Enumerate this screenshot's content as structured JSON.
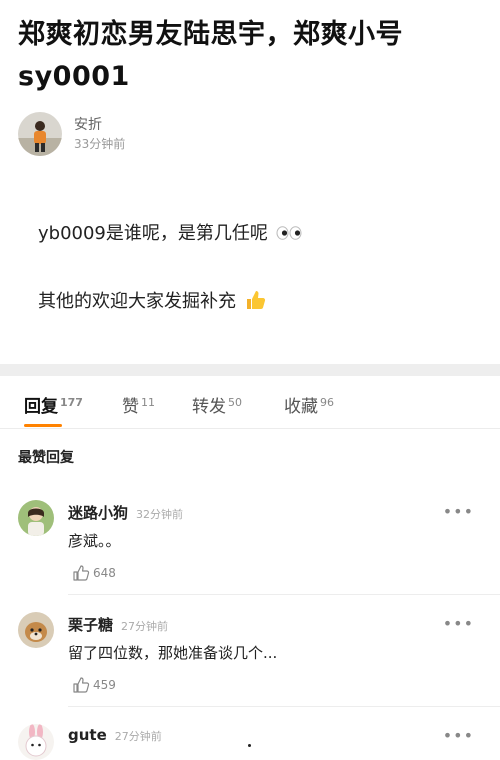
{
  "post": {
    "title": "郑爽初恋男友陆思宇，郑爽小号sy0001",
    "author": {
      "name": "安折",
      "time": "33分钟前"
    },
    "lines": [
      "yb0009是谁呢，是第几任呢",
      "其他的欢迎大家发掘补充"
    ]
  },
  "tabs": [
    {
      "label": "回复",
      "count": "177"
    },
    {
      "label": "赞",
      "count": "11"
    },
    {
      "label": "转发",
      "count": "50"
    },
    {
      "label": "收藏",
      "count": "96"
    }
  ],
  "section_title": "最赞回复",
  "comments": [
    {
      "name": "迷路小狗",
      "time": "32分钟前",
      "text": "彦斌。。",
      "likes": "648"
    },
    {
      "name": "栗子糖",
      "time": "27分钟前",
      "text": "留了四位数，那她准备谈几个...",
      "likes": "459"
    },
    {
      "name": "gute",
      "time": "27分钟前",
      "text": "",
      "likes": ""
    }
  ],
  "more_label": "•••",
  "colors": {
    "accent": "#ff8200",
    "band": "#eeeeee"
  }
}
